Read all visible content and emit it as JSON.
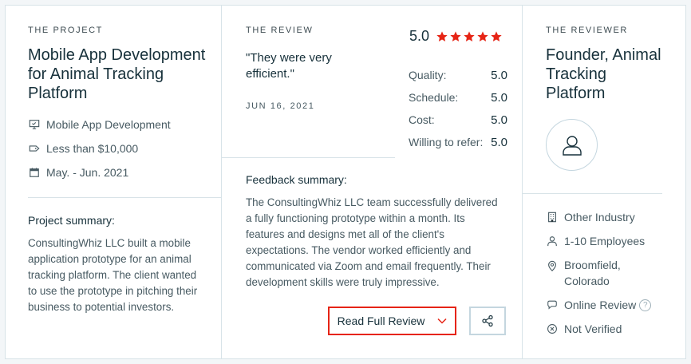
{
  "project": {
    "eyebrow": "THE PROJECT",
    "title_line1": "Mobile App Development",
    "title_line2": "for Animal Tracking",
    "title_line3": "Platform",
    "service": "Mobile App Development",
    "budget": "Less than $10,000",
    "dates": "May. - Jun. 2021",
    "summary_label": "Project summary:",
    "summary_lines": [
      "ConsultingWhiz LLC built a mobile",
      "application prototype for an animal",
      "tracking platform. The client wanted",
      "to use the prototype in pitching their",
      "business to potential investors."
    ]
  },
  "review": {
    "eyebrow": "THE REVIEW",
    "quote_line1": "\"They were very",
    "quote_line2": "efficient.\"",
    "date": "JUN 16, 2021",
    "overall": "5.0",
    "star_count": 5,
    "star_color": "#e62415",
    "scores": [
      {
        "label": "Quality:",
        "value": "5.0"
      },
      {
        "label": "Schedule:",
        "value": "5.0"
      },
      {
        "label": "Cost:",
        "value": "5.0"
      },
      {
        "label": "Willing to refer:",
        "value": "5.0"
      }
    ],
    "feedback_label": "Feedback summary:",
    "feedback_lines": [
      "The ConsultingWhiz LLC team successfully delivered",
      "a fully functioning prototype within a month. Its",
      "features and designs met all of the client's",
      "expectations. The vendor worked efficiently and",
      "communicated via Zoom and email frequently. Their",
      "development skills were truly impressive."
    ],
    "read_button": "Read Full Review",
    "share_icon": "share-icon"
  },
  "reviewer": {
    "eyebrow": "THE REVIEWER",
    "title_line1": "Founder, Animal",
    "title_line2": "Tracking",
    "title_line3": "Platform",
    "industry": "Other Industry",
    "employees": "1-10 Employees",
    "location_line1": "Broomfield,",
    "location_line2": "Colorado",
    "review_type": "Online Review",
    "help_glyph": "?",
    "verification": "Not Verified"
  }
}
